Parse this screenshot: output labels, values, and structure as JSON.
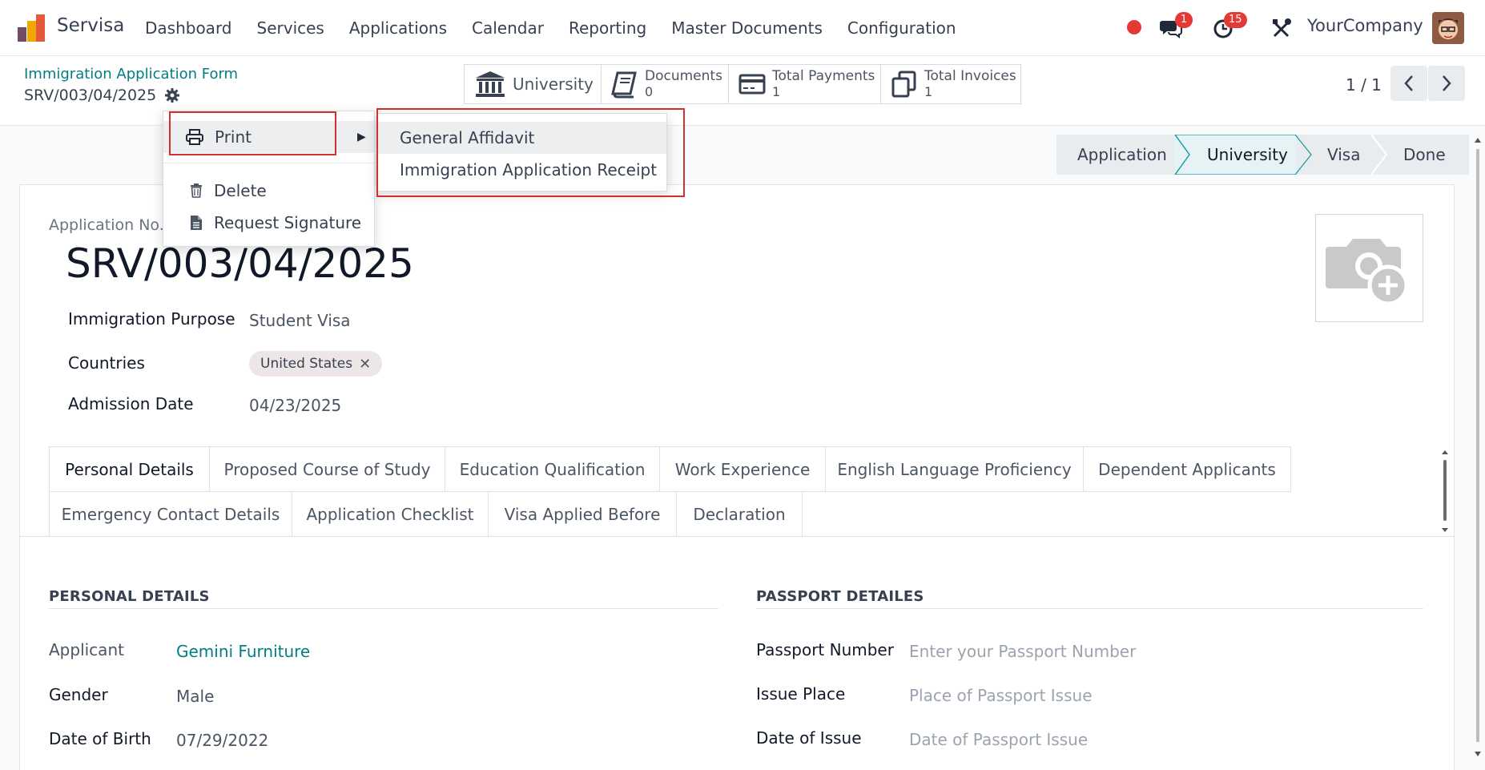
{
  "navbar": {
    "app_name": "Servisa",
    "menu": [
      "Dashboard",
      "Services",
      "Applications",
      "Calendar",
      "Reporting",
      "Master Documents",
      "Configuration"
    ],
    "messages_badge": "1",
    "activities_badge": "15",
    "company": "YourCompany"
  },
  "breadcrumb": {
    "parent": "Immigration Application Form",
    "record": "SRV/003/04/2025"
  },
  "smart_buttons": {
    "university": {
      "label": "University"
    },
    "documents": {
      "label": "Documents",
      "value": "0"
    },
    "payments": {
      "label": "Total Payments",
      "value": "1"
    },
    "invoices": {
      "label": "Total Invoices",
      "value": "1"
    }
  },
  "pager": {
    "text": "1 / 1"
  },
  "status_stages": [
    "Application",
    "University",
    "Visa",
    "Done"
  ],
  "status_active": "University",
  "actions_menu": {
    "print": "Print",
    "delete": "Delete",
    "request_signature": "Request Signature"
  },
  "print_submenu": [
    "General Affidavit",
    "Immigration Application Receipt"
  ],
  "form": {
    "app_no_label": "Application No.",
    "app_no": "SRV/003/04/2025",
    "purpose_label": "Immigration Purpose",
    "purpose": "Student Visa",
    "countries_label": "Countries",
    "country_tag": "United States",
    "admission_label": "Admission Date",
    "admission_date": "04/23/2025"
  },
  "tabs_row1": [
    "Personal Details",
    "Proposed Course of Study",
    "Education Qualification",
    "Work Experience",
    "English Language Proficiency",
    "Dependent Applicants"
  ],
  "tabs_row2": [
    "Emergency Contact Details",
    "Application Checklist",
    "Visa Applied Before",
    "Declaration"
  ],
  "personal": {
    "title": "PERSONAL DETAILS",
    "applicant_label": "Applicant",
    "applicant": "Gemini Furniture",
    "gender_label": "Gender",
    "gender": "Male",
    "dob_label": "Date of Birth",
    "dob": "07/29/2022"
  },
  "passport": {
    "title": "PASSPORT DETAILES",
    "number_label": "Passport Number",
    "number_ph": "Enter your Passport Number",
    "place_label": "Issue Place",
    "place_ph": "Place of Passport Issue",
    "date_label": "Date of Issue",
    "date_ph": "Date of Passport Issue"
  },
  "colors": {
    "accent": "#017e84",
    "brand": "#714b67",
    "highlight_box": "#d32f2f"
  }
}
